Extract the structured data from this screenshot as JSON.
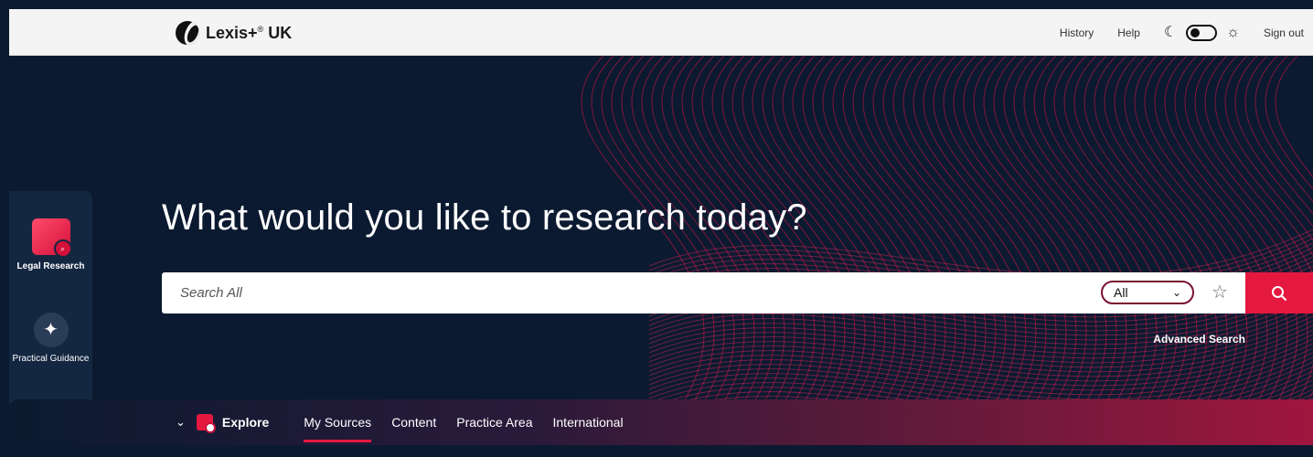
{
  "header": {
    "brand": "Lexis+",
    "brand_mark": "®",
    "brand_suffix": "UK",
    "nav": {
      "history": "History",
      "help": "Help",
      "sign_out": "Sign out"
    },
    "theme_toggle": {
      "icons": [
        "moon-icon",
        "sun-icon"
      ]
    }
  },
  "sidebar": {
    "items": [
      {
        "label": "Legal Research",
        "icon": "legal-research-icon"
      },
      {
        "label": "Practical Guidance",
        "icon": "sparkle-icon"
      },
      {
        "label": "",
        "icon": "document-icon"
      }
    ]
  },
  "hero": {
    "headline": "What would you like to research today?"
  },
  "search": {
    "placeholder": "Search All",
    "scope_value": "All",
    "advanced_label": "Advanced Search"
  },
  "explore": {
    "title": "Explore",
    "tabs": [
      "My Sources",
      "Content",
      "Practice Area",
      "International"
    ],
    "active_tab": "My Sources"
  },
  "colors": {
    "accent": "#e5183f",
    "background": "#0b1a30",
    "sidebar": "#142741"
  }
}
